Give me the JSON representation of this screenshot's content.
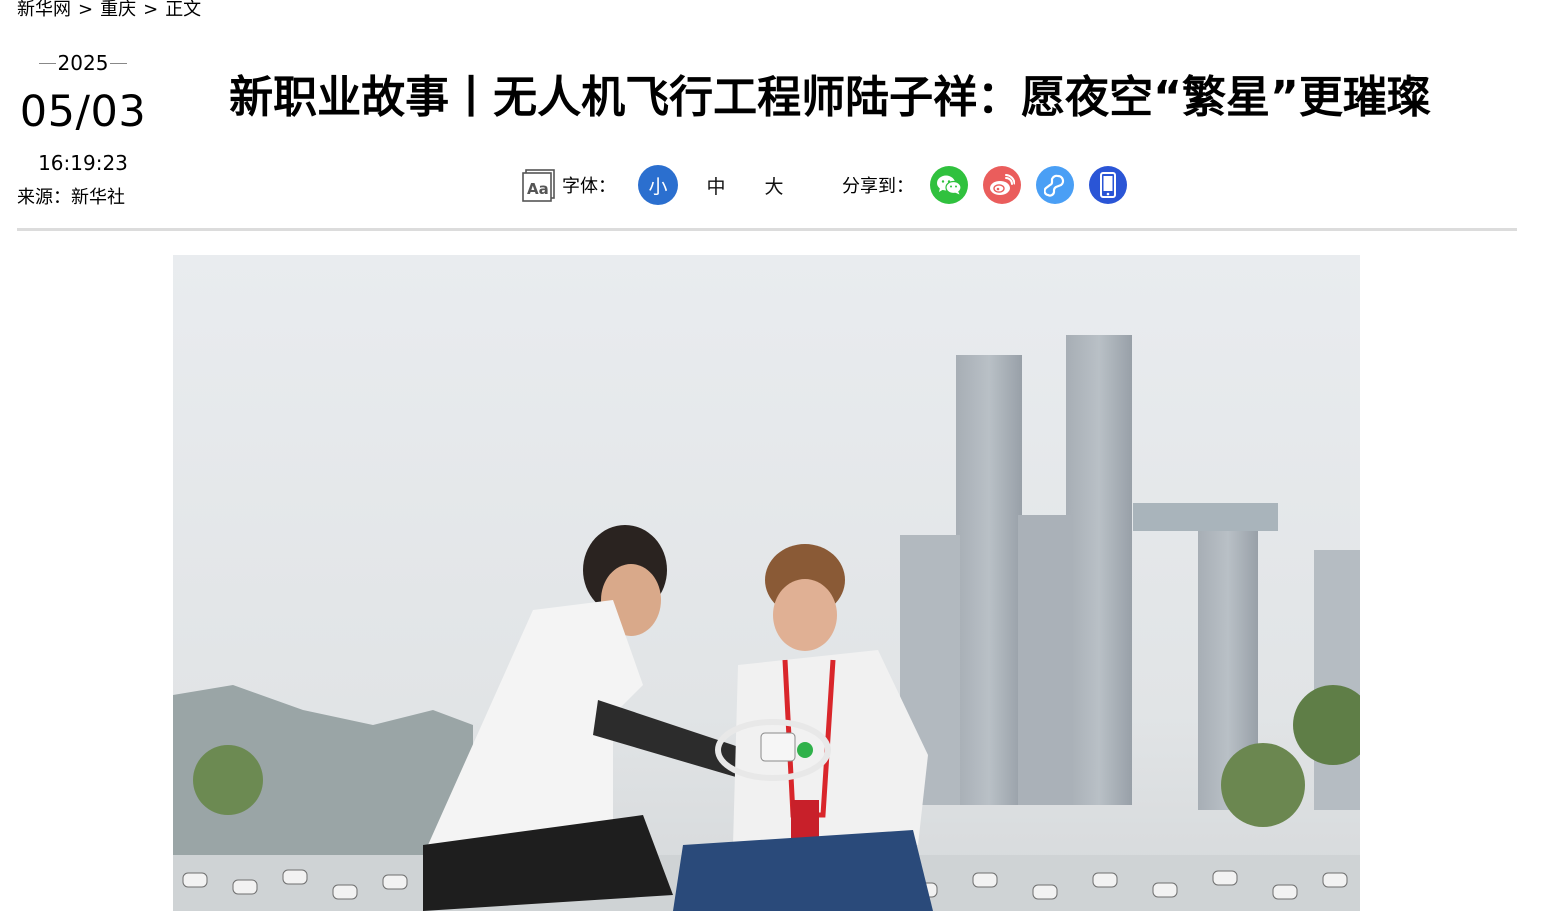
{
  "breadcrumb": {
    "items": [
      "新华网",
      "重庆",
      "正文"
    ],
    "separator": ">"
  },
  "date": {
    "year": "2025",
    "month_day": "05/03",
    "time": "16:19:23"
  },
  "source": "来源：新华社",
  "title": "新职业故事丨无人机飞行工程师陆子祥：愿夜空“繁星”更璀璨",
  "toolbar": {
    "font_label": "字体：",
    "sizes": [
      "小",
      "中",
      "大"
    ],
    "active_size": "小",
    "share_label": "分享到：",
    "share_targets": [
      "wechat-icon",
      "weibo-icon",
      "mini-program-icon",
      "mobile-icon"
    ]
  },
  "colors": {
    "active_size_bg": "#2b6fcf",
    "wechat": "#30c13e",
    "weibo": "#ea5d5c",
    "mini_program": "#4a9ff5",
    "mobile": "#2a55d6",
    "divider": "#dcdcdc"
  }
}
